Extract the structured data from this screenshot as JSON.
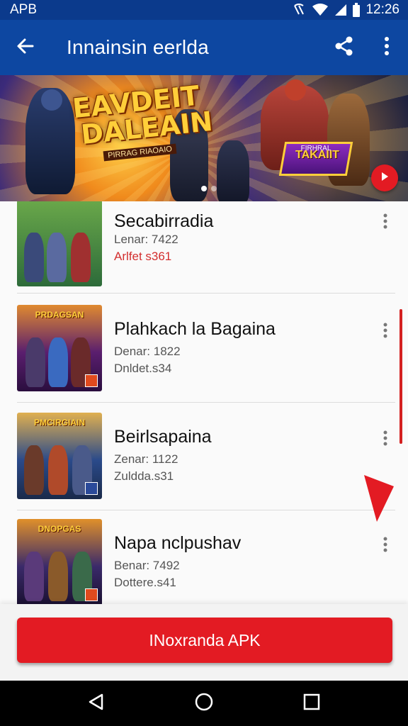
{
  "status_bar": {
    "left_text": "APB",
    "time": "12:26",
    "icons": [
      "nfc-icon",
      "wifi-icon",
      "signal-icon",
      "battery-icon"
    ]
  },
  "app_bar": {
    "title": "Innainsin eerlda",
    "icons": [
      "back-arrow-icon",
      "share-icon",
      "more-vert-icon"
    ]
  },
  "banner": {
    "title_line1": "EAVDEIT",
    "title_line2": "DALEAIN",
    "subtitle": "PIRRAG RIAOAIO",
    "tag_top": "FIRHRAL",
    "tag_text": "TAKAIIT",
    "dots": 2,
    "active_dot": 0
  },
  "list": {
    "items": [
      {
        "title": "Secabirradia",
        "line1": "Lenar: 7422",
        "line2": "Arlfet s361",
        "line2_style": "red",
        "thumb_title": "",
        "thumb_colors": [
          "#2d6b3a",
          "#7a9c4a"
        ]
      },
      {
        "title": "Plahkach la Bagaina",
        "line1": "Denar: 1822",
        "line2": "Dnldet.s34",
        "line2_style": "gray",
        "thumb_title": "PRDAGSAN",
        "thumb_colors": [
          "#5a1e6e",
          "#e07a2a"
        ]
      },
      {
        "title": "Beirlsapaina",
        "line1": "Zenar: 1122",
        "line2": "Zuldda.s31",
        "line2_style": "gray",
        "thumb_title": "PMCIRGIAIN",
        "thumb_colors": [
          "#2a4a8a",
          "#e0a040"
        ]
      },
      {
        "title": "Napa nclpushav",
        "line1": "Benar: 7492",
        "line2": "Dottere.s41",
        "line2_style": "gray",
        "thumb_title": "DNOPGAS",
        "thumb_colors": [
          "#3a2a6a",
          "#e0902a"
        ]
      }
    ]
  },
  "cta": {
    "label": "INoxranda APK"
  },
  "colors": {
    "app_bar": "#0d47a1",
    "status_bar": "#0b3a8c",
    "accent_red": "#e31b23"
  }
}
